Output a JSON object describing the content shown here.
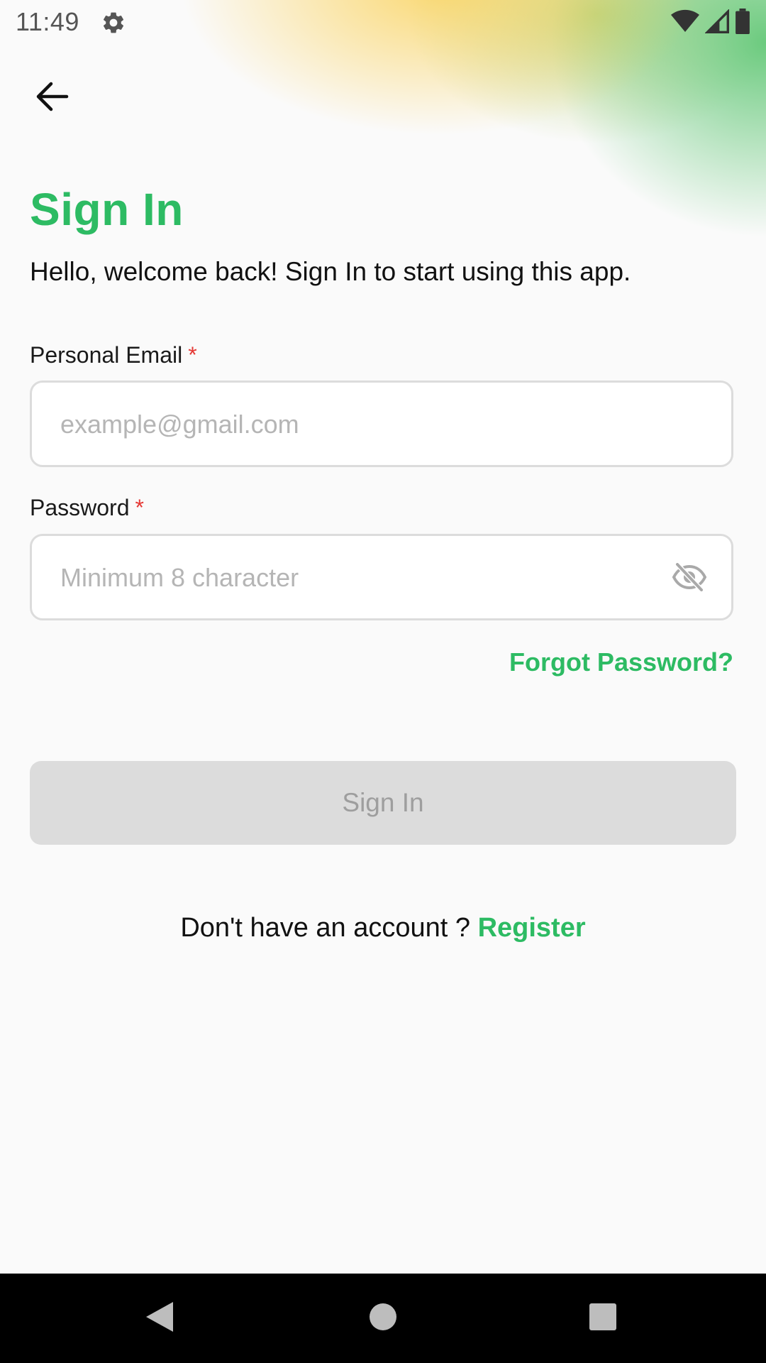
{
  "status_bar": {
    "time": "11:49",
    "icons": [
      "gear-icon",
      "wifi-icon",
      "signal-icon",
      "battery-icon"
    ]
  },
  "header": {
    "back_icon": "arrow-left-icon"
  },
  "page": {
    "title": "Sign In",
    "subtitle": "Hello, welcome back! Sign In to start using this app."
  },
  "form": {
    "email": {
      "label": "Personal Email",
      "required_mark": "*",
      "placeholder": "example@gmail.com",
      "value": ""
    },
    "password": {
      "label": "Password",
      "required_mark": "*",
      "placeholder": "Minimum 8 character",
      "value": "",
      "toggle_icon": "eye-off-icon"
    },
    "forgot_label": "Forgot Password?",
    "submit_label": "Sign In"
  },
  "footer": {
    "prompt": "Don't have an account ? ",
    "register_label": "Register"
  },
  "nav_bar": {
    "icons": [
      "back-triangle-icon",
      "home-circle-icon",
      "recents-square-icon"
    ]
  },
  "colors": {
    "accent": "#2dbb63",
    "required": "#e53935",
    "disabled_bg": "#dcdcdc",
    "disabled_text": "#9e9e9e"
  }
}
